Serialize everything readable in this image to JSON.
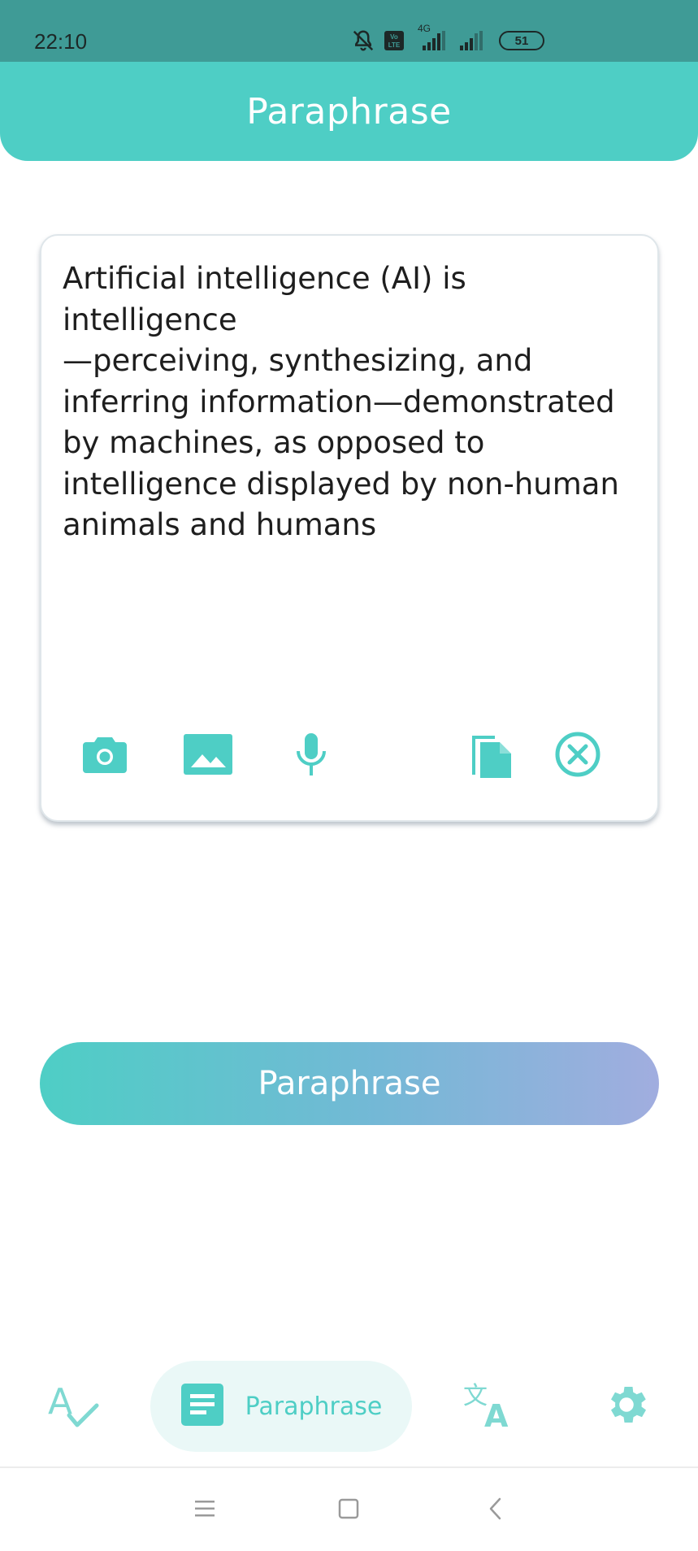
{
  "status_bar": {
    "time": "22:10",
    "network_label": "4G",
    "volte_label": "Vo LTE",
    "battery": "51",
    "icons": [
      "bell-muted-icon",
      "volte-icon",
      "signal-icon",
      "signal-icon",
      "battery-icon"
    ]
  },
  "header": {
    "title": "Paraphrase"
  },
  "input": {
    "text": "Artificial intelligence (AI) is intelligence\n—perceiving, synthesizing, and\ninferring information—demonstrated\nby machines, as opposed to\nintelligence displayed by non-human\nanimals and humans",
    "tools": [
      "camera-icon",
      "image-icon",
      "microphone-icon",
      "paste-icon",
      "clear-icon"
    ]
  },
  "action": {
    "button_label": "Paraphrase"
  },
  "bottom_nav": {
    "items": [
      {
        "icon": "spell-check-icon",
        "label": ""
      },
      {
        "icon": "document-icon",
        "label": "Paraphrase",
        "active": true
      },
      {
        "icon": "translate-icon",
        "label": ""
      },
      {
        "icon": "gear-icon",
        "label": ""
      }
    ]
  },
  "colors": {
    "accent": "#4ecec5",
    "status_bar": "#3f9b96",
    "gradient_end": "#a1addf",
    "nav_active_bg": "#eaf8f7"
  }
}
